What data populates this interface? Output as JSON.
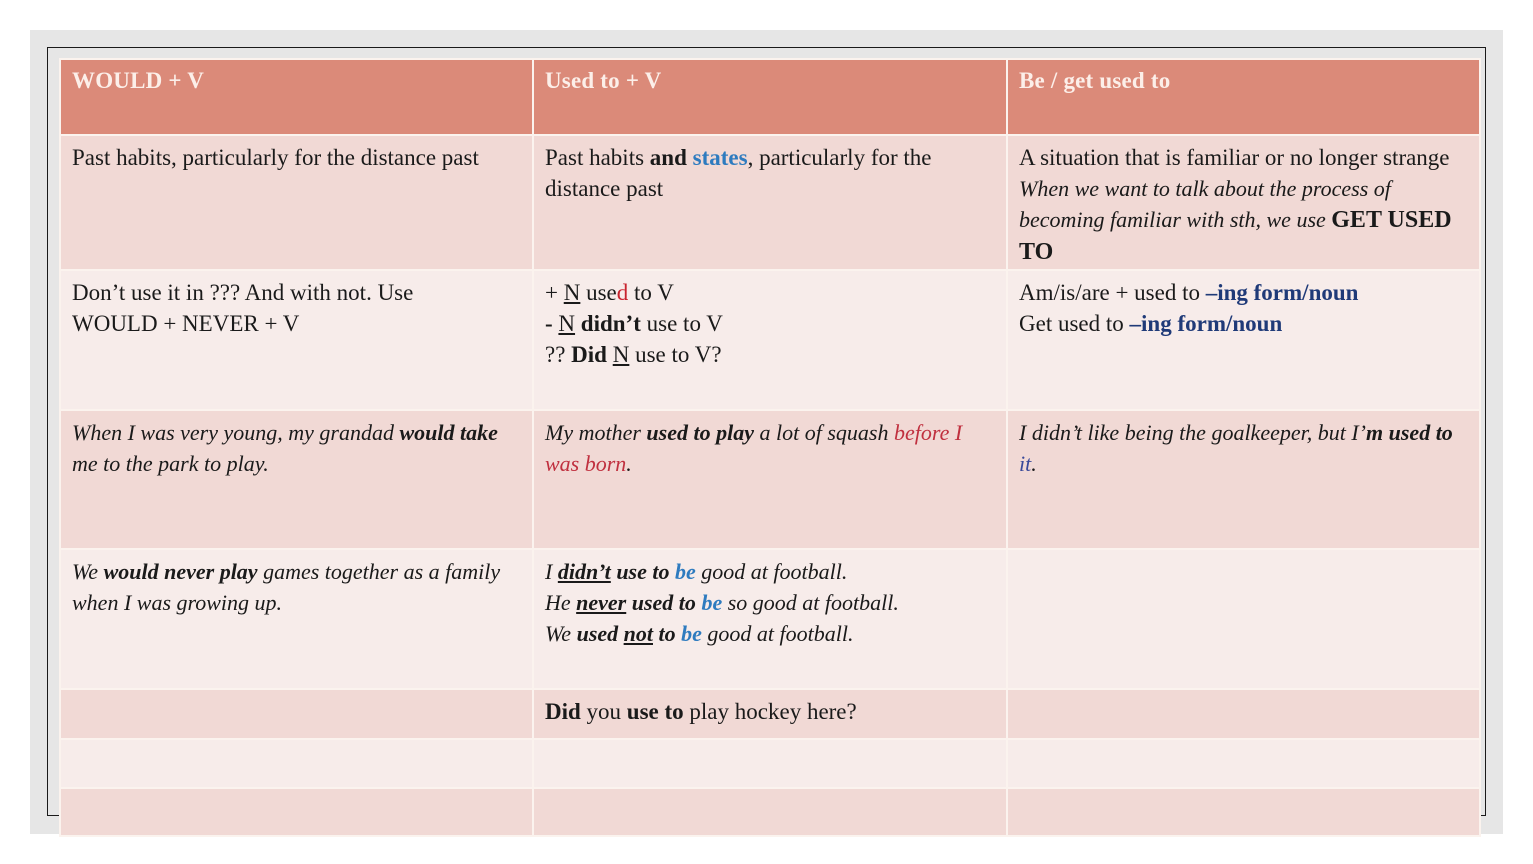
{
  "table": {
    "headers": [
      "WOULD + V",
      "Used to + V",
      "Be / get used to"
    ],
    "rows": [
      {
        "would": {
          "text": "Past habits, particularly for the distance past"
        },
        "used_to": {
          "p1": "Past habits ",
          "and": "and",
          "sp": " ",
          "states": "states",
          "p2": ", particularly for the distance past"
        },
        "be_get": {
          "line1": "A situation that is familiar or no longer strange",
          "italic": "When we want to talk about the process of  becoming familiar with sth, we use ",
          "bold": "GET USED TO"
        }
      },
      {
        "would": {
          "line1": "Don’t use it in ??? And with not. Use",
          "line2": "WOULD + NEVER + V"
        },
        "used_to": {
          "l1_plus": "+ ",
          "l1_n": "N",
          "l1_use": " use",
          "l1_d": "d",
          "l1_rest": " to V",
          "l2_minus": "- ",
          "l2_n": "N",
          "l2_didnt": " didn’t",
          "l2_rest": " use to V",
          "l3_q": "?? ",
          "l3_did": "Did",
          "l3_sp": " ",
          "l3_n": "N",
          "l3_rest": " use to V?"
        },
        "be_get": {
          "l1_a": "Am/is/are + used to ",
          "l1_b": "–ing form/noun",
          "l2_a": "Get used to ",
          "l2_b": "–ing form/noun"
        }
      },
      {
        "would": {
          "a": "When I was very young, my grandad ",
          "bold": "would take",
          "b": " me to the park to play."
        },
        "used_to": {
          "a": "My mother ",
          "bold": "used to play",
          "b": " a lot of  squash ",
          "red": "before I was born",
          "end": "."
        },
        "be_get": {
          "a": "I didn’t like being the goalkeeper, but I’",
          "bold": "m used to",
          "sp": " ",
          "it": "it",
          "end": "."
        }
      },
      {
        "would": {
          "a": "We ",
          "bold": "would never play",
          "b": " games together as a family when I was growing up."
        },
        "used_to": {
          "s1": {
            "a": "I ",
            "u": "didn’t",
            "b": " use to ",
            "be": "be",
            "c": " good at football."
          },
          "s2": {
            "a": "He ",
            "u": "never",
            "b": " used to ",
            "be": "be",
            "c": " so good at football."
          },
          "s3": {
            "a": "We ",
            "b1": "used ",
            "u": "not",
            "b2": " to ",
            "be": "be",
            "c": " good at football."
          }
        },
        "be_get": {
          "text": ""
        }
      },
      {
        "would": {
          "text": ""
        },
        "used_to": {
          "did": "Did",
          "a": " you ",
          "use_to": "use to",
          "b": " play hockey here?"
        },
        "be_get": {
          "text": ""
        }
      },
      {
        "would": {
          "text": ""
        },
        "used_to": {
          "text": ""
        },
        "be_get": {
          "text": ""
        }
      },
      {
        "would": {
          "text": ""
        },
        "used_to": {
          "text": ""
        },
        "be_get": {
          "text": ""
        }
      }
    ]
  },
  "colors": {
    "header_bg": "#db8a79",
    "row_dark_bg": "#f1d9d5",
    "row_light_bg": "#f7ecea",
    "accent_blue": "#2e7bbf",
    "accent_navy": "#1f3a78",
    "accent_red": "#c8242f"
  }
}
